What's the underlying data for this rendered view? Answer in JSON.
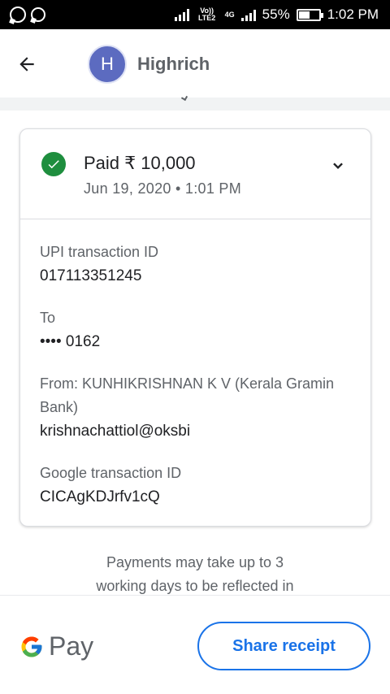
{
  "status_bar": {
    "network_label_top": "Vo)) LTE2",
    "network_label_4g": "4G",
    "battery": "55%",
    "time": "1:02 PM"
  },
  "header": {
    "avatar_letter": "H",
    "title": "Highrich"
  },
  "payment": {
    "status_amount": "Paid ₹ 10,000",
    "datetime": "Jun 19, 2020 • 1:01 PM",
    "status_color": "#1e8e3e"
  },
  "details": [
    {
      "label": "UPI transaction ID",
      "value": "017113351245"
    },
    {
      "label": "To",
      "value": "•••• 0162"
    },
    {
      "label": "From: KUNHIKRISHNAN K V (Kerala Gramin Bank)",
      "value": "krishnachattiol@oksbi"
    },
    {
      "label": "Google transaction ID",
      "value": "CICAgKDJrfv1cQ"
    }
  ],
  "note": {
    "line1": "Payments may take up to 3",
    "line2": "working days to be reflected in"
  },
  "footer": {
    "brand": "Pay",
    "share_label": "Share receipt",
    "accent": "#1a73e8"
  }
}
